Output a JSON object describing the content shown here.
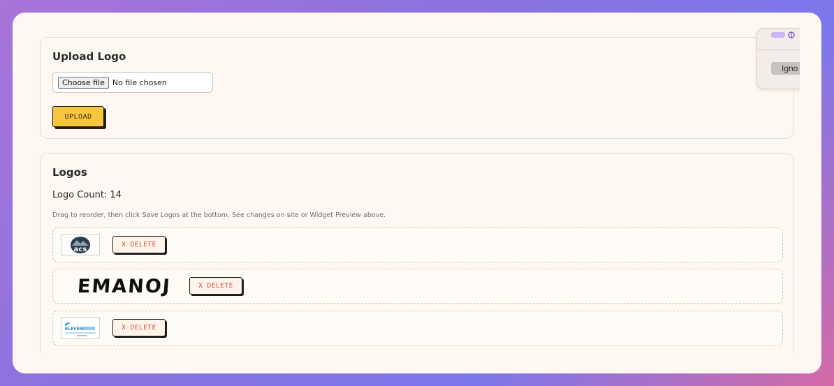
{
  "upload_panel": {
    "title": "Upload Logo",
    "choose_file_label": "Choose file",
    "file_status": "No file chosen",
    "upload_label": "UPLOAD"
  },
  "logos_panel": {
    "title": "Logos",
    "count_text": "Logo Count: 14",
    "hint": "Drag to reorder, then click Save Logos at the bottom. See changes on site or Widget Preview above.",
    "items": [
      {
        "logo_text": "acs",
        "delete_label": "X DELETE"
      },
      {
        "logo_text": "EMANOJ",
        "delete_label": "X DELETE"
      },
      {
        "logo_text": "ELEVEN",
        "delete_label": "X DELETE"
      }
    ]
  },
  "popup": {
    "ignore_label": "Igno"
  },
  "colors": {
    "upload_button": "#f6c63f",
    "delete_text": "#d64b3a",
    "card_bg": "#fff8f2"
  }
}
